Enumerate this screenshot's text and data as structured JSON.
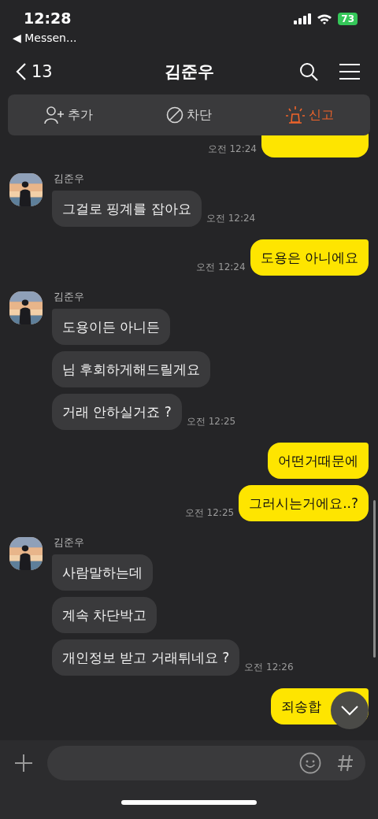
{
  "status_bar": {
    "time": "12:28",
    "back_app": "◀ Messen...",
    "battery": "73"
  },
  "header": {
    "back_count": "13",
    "title": "김준우"
  },
  "actions": [
    {
      "kind": "add",
      "label": "추가"
    },
    {
      "kind": "block",
      "label": "차단"
    },
    {
      "kind": "report",
      "label": "신고"
    }
  ],
  "groups": [
    {
      "messages": [
        {
          "time": "오전 12:24"
        }
      ]
    },
    {
      "sender": "김준우",
      "messages": [
        {
          "text": "그걸로 핑계를 잡아요",
          "time": "오전 12:24"
        }
      ]
    },
    {
      "messages": [
        {
          "text": "도용은 아니에요",
          "time": "오전 12:24"
        }
      ]
    },
    {
      "sender": "김준우",
      "messages": [
        {
          "text": "도용이든 아니든"
        },
        {
          "text": "님 후회하게해드릴게요"
        },
        {
          "text": "거래 안하실거죠 ?",
          "time": "오전 12:25"
        }
      ]
    },
    {
      "messages": [
        {
          "text": "어떤거때문에"
        },
        {
          "text": "그러시는거에요..?",
          "time": "오전 12:25"
        }
      ]
    },
    {
      "sender": "김준우",
      "messages": [
        {
          "text": "사람말하는데"
        },
        {
          "text": "계속 차단박고"
        },
        {
          "text": "개인정보 받고 거래튀네요 ?",
          "time": "오전 12:26"
        }
      ]
    },
    {
      "messages": [
        {
          "text": "죄송합"
        }
      ]
    }
  ]
}
